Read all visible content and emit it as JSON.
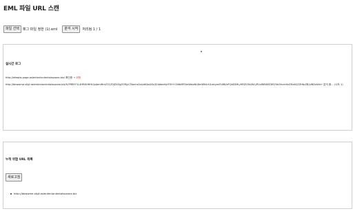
{
  "page": {
    "title": "EML 파일 URL 스캔"
  },
  "toolbar": {
    "file_button_label": "파일 선택",
    "file_name_text": "뽀그 파일 정한 (1).eml",
    "start_button_label": "분석 시작",
    "selected_count_text": "처리됨 1 / 1"
  },
  "log_panel": {
    "title": "실시간 로그",
    "lines": [
      {
        "text": "http://elewbs.page.aslentenlonlentalsozone.biz/ 확인중 → ",
        "status": "위험"
      },
      {
        "text": "http://bkwwme.sfyjf.aslentenlonlentalsozone.biz/fr/FRBYY1L4HRKHHHUjvjbmIHmZ11Z0JZXZgZOfIjyC5lonhs5xlydKAv/i0k/Z/ddeeHytF5H+1NtbMFSmWewNLBmWNLrULmtymlFdWl/eFQkE0ML/HRZ03kl/WL/PUvWB0MZW3/Vb3hcmHxZKv6GZZHfpZB/yWDxWd+ 분석 중... (시도 1)",
        "status": ""
      }
    ],
    "colors": {
      "danger": "#d9362b"
    }
  },
  "result_panel": {
    "title": "누적 위험 URL 목록",
    "refresh_button_label": "새로고침",
    "items": [
      "http://bkwwme.sfyjf.aslentenlonlentalsozone.biz"
    ]
  }
}
